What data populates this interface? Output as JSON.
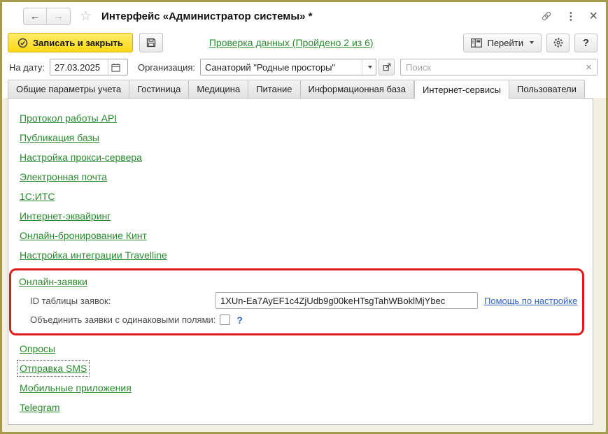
{
  "window": {
    "title": "Интерфейс «Администратор системы» *"
  },
  "icons": {
    "back_arrow": "←",
    "forward_arrow": "→",
    "favorite_star": "☆",
    "more_menu": "⋮",
    "close_window": "×",
    "clear_search": "×",
    "help": "?",
    "merge_help": "?"
  },
  "toolbar": {
    "save_and_close": "Записать и закрыть",
    "data_check_link": "Проверка данных (Пройдено 2 из 6)",
    "goto": "Перейти"
  },
  "filters": {
    "date_label": "На дату:",
    "date_value": "27.03.2025",
    "org_label": "Организация:",
    "org_value": "Санаторий \"Родные просторы\"",
    "search_placeholder": "Поиск"
  },
  "tabs": {
    "items": [
      "Общие параметры учета",
      "Гостиница",
      "Медицина",
      "Питание",
      "Информационная база",
      "Интернет-сервисы",
      "Пользователи"
    ],
    "active": "Интернет-сервисы"
  },
  "content": {
    "links_top": [
      "Протокол работы API",
      "Публикация базы",
      "Настройка прокси-сервера",
      "Электронная почта",
      "1С:ИТС",
      "Интернет-эквайринг",
      "Онлайн-бронирование Кинт",
      "Настройка интеграции Travelline"
    ],
    "online_requests": {
      "section_link": "Онлайн-заявки",
      "id_label": "ID таблицы заявок:",
      "id_value": "1XUn-Ea7AyEF1c4ZjUdb9g00keHTsgTahWBoklMjYbec",
      "help_link": "Помощь по настройке",
      "merge_label": "Объединить заявки с одинаковыми полями:",
      "merge_checked": false
    },
    "links_bottom": [
      "Опросы",
      "Отправка SMS",
      "Мобильные приложения",
      "Telegram"
    ],
    "focused_link": "Отправка SMS"
  },
  "colors": {
    "primary_button_yellow": "#FFDD1C",
    "link_green": "#2B8A2F",
    "link_blue": "#3464C8",
    "highlight_red": "#E11B1B",
    "window_border_olive": "#A89A4C"
  }
}
